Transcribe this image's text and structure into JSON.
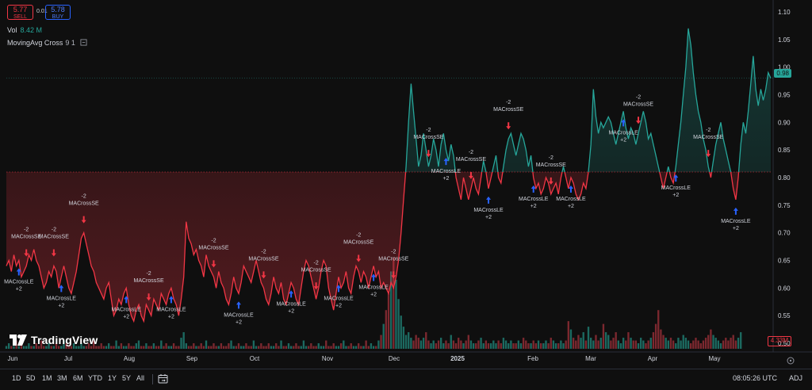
{
  "quote": {
    "sell_price": "5.77",
    "sell_label": "SELL",
    "spread": "0.01",
    "buy_price": "5.78",
    "buy_label": "BUY"
  },
  "legend": {
    "volume_label": "Vol",
    "volume_value": "8.42 M",
    "indicator_name": "MovingAvg Cross",
    "indicator_params": "9 1"
  },
  "watermark": "TradingView",
  "price_axis": [
    "1.10",
    "1.05",
    "1.00",
    "0.95",
    "0.90",
    "0.85",
    "0.80",
    "0.75",
    "0.70",
    "0.65",
    "0.60",
    "0.55",
    "0.50"
  ],
  "current_price_tag": "0.98",
  "volume_tag": "4.33M",
  "time_axis": [
    {
      "label": "Jun",
      "bold": false
    },
    {
      "label": "Jul",
      "bold": false
    },
    {
      "label": "Aug",
      "bold": false
    },
    {
      "label": "Sep",
      "bold": false
    },
    {
      "label": "Oct",
      "bold": false
    },
    {
      "label": "Nov",
      "bold": false
    },
    {
      "label": "Dec",
      "bold": false
    },
    {
      "label": "2025",
      "bold": true
    },
    {
      "label": "Feb",
      "bold": false
    },
    {
      "label": "Mar",
      "bold": false
    },
    {
      "label": "Apr",
      "bold": false
    },
    {
      "label": "May",
      "bold": false
    }
  ],
  "toolbar": {
    "timeframes": [
      "1D",
      "5D",
      "1M",
      "3M",
      "6M",
      "YTD",
      "1Y",
      "5Y",
      "All"
    ],
    "clock": "08:05:26 UTC",
    "adj": "ADJ"
  },
  "signal_labels": {
    "short": "MACrossSE",
    "long": "MACrossLE",
    "short_qty": "-2",
    "long_qty": "+2"
  },
  "colors": {
    "up": "#26a69a",
    "down": "#f23645",
    "long_arrow": "#2962ff",
    "short_arrow": "#f23645",
    "background": "#0f0f0f",
    "axis_text": "#d1d4dc"
  },
  "chart_data": {
    "type": "baseline",
    "baseline": 0.81,
    "ylim": [
      0.49,
      1.11
    ],
    "price_series": [
      0.64,
      0.65,
      0.63,
      0.66,
      0.64,
      0.65,
      0.62,
      0.63,
      0.64,
      0.66,
      0.65,
      0.67,
      0.65,
      0.64,
      0.62,
      0.6,
      0.61,
      0.63,
      0.62,
      0.64,
      0.63,
      0.6,
      0.62,
      0.64,
      0.62,
      0.6,
      0.59,
      0.61,
      0.63,
      0.66,
      0.69,
      0.7,
      0.68,
      0.66,
      0.64,
      0.63,
      0.61,
      0.6,
      0.59,
      0.58,
      0.6,
      0.61,
      0.58,
      0.55,
      0.56,
      0.58,
      0.57,
      0.59,
      0.6,
      0.57,
      0.55,
      0.54,
      0.56,
      0.57,
      0.55,
      0.54,
      0.57,
      0.56,
      0.55,
      0.58,
      0.57,
      0.56,
      0.59,
      0.58,
      0.57,
      0.59,
      0.6,
      0.58,
      0.57,
      0.55,
      0.58,
      0.62,
      0.72,
      0.69,
      0.68,
      0.66,
      0.67,
      0.65,
      0.64,
      0.62,
      0.66,
      0.64,
      0.63,
      0.62,
      0.6,
      0.63,
      0.61,
      0.6,
      0.58,
      0.57,
      0.59,
      0.62,
      0.6,
      0.59,
      0.61,
      0.64,
      0.63,
      0.62,
      0.61,
      0.63,
      0.65,
      0.63,
      0.61,
      0.6,
      0.58,
      0.57,
      0.59,
      0.62,
      0.6,
      0.59,
      0.61,
      0.58,
      0.57,
      0.59,
      0.61,
      0.6,
      0.58,
      0.57,
      0.6,
      0.63,
      0.65,
      0.64,
      0.62,
      0.6,
      0.58,
      0.6,
      0.63,
      0.65,
      0.64,
      0.6,
      0.58,
      0.56,
      0.59,
      0.62,
      0.6,
      0.61,
      0.63,
      0.6,
      0.59,
      0.62,
      0.64,
      0.63,
      0.61,
      0.63,
      0.62,
      0.6,
      0.62,
      0.64,
      0.62,
      0.63,
      0.6,
      0.61,
      0.6,
      0.59,
      0.61,
      0.6,
      0.62,
      0.65,
      0.7,
      0.76,
      0.82,
      0.9,
      0.97,
      0.92,
      0.87,
      0.82,
      0.84,
      0.88,
      0.85,
      0.82,
      0.84,
      0.87,
      0.85,
      0.82,
      0.86,
      0.88,
      0.85,
      0.83,
      0.86,
      0.84,
      0.8,
      0.78,
      0.76,
      0.8,
      0.78,
      0.76,
      0.78,
      0.8,
      0.78,
      0.77,
      0.8,
      0.83,
      0.81,
      0.78,
      0.8,
      0.82,
      0.84,
      0.8,
      0.79,
      0.82,
      0.85,
      0.87,
      0.88,
      0.86,
      0.84,
      0.86,
      0.88,
      0.87,
      0.85,
      0.82,
      0.84,
      0.8,
      0.78,
      0.79,
      0.77,
      0.78,
      0.8,
      0.79,
      0.77,
      0.78,
      0.79,
      0.77,
      0.8,
      0.82,
      0.8,
      0.78,
      0.8,
      0.79,
      0.77,
      0.76,
      0.77,
      0.79,
      0.78,
      0.81,
      0.86,
      0.96,
      0.91,
      0.88,
      0.9,
      0.89,
      0.9,
      0.91,
      0.9,
      0.88,
      0.86,
      0.88,
      0.9,
      0.92,
      0.89,
      0.87,
      0.89,
      0.88,
      0.86,
      0.88,
      0.9,
      0.92,
      0.9,
      0.87,
      0.88,
      0.86,
      0.84,
      0.82,
      0.8,
      0.78,
      0.8,
      0.82,
      0.8,
      0.79,
      0.82,
      0.86,
      0.9,
      0.95,
      1.0,
      1.07,
      1.04,
      0.99,
      0.95,
      0.92,
      0.9,
      0.87,
      0.85,
      0.82,
      0.8,
      0.83,
      0.86,
      0.88,
      0.9,
      0.87,
      0.85,
      0.83,
      0.81,
      0.78,
      0.76,
      0.8,
      0.86,
      0.9,
      0.88,
      0.92,
      0.97,
      1.02,
      0.96,
      0.93,
      0.96,
      0.94,
      0.96,
      0.99,
      0.98
    ],
    "volume_series": [
      1,
      2,
      1,
      1,
      3,
      1,
      2,
      1,
      1,
      2,
      1,
      1,
      2,
      1,
      3,
      1,
      1,
      2,
      1,
      1,
      2,
      1,
      1,
      3,
      2,
      1,
      1,
      2,
      1,
      1,
      2,
      1,
      1,
      2,
      1,
      3,
      1,
      1,
      2,
      1,
      1,
      2,
      1,
      1,
      3,
      1,
      2,
      1,
      1,
      2,
      1,
      1,
      2,
      3,
      1,
      1,
      2,
      1,
      1,
      2,
      1,
      1,
      3,
      1,
      2,
      1,
      1,
      2,
      1,
      1,
      4,
      6,
      2,
      1,
      1,
      2,
      1,
      1,
      2,
      1,
      3,
      1,
      1,
      2,
      1,
      1,
      2,
      1,
      1,
      2,
      3,
      1,
      1,
      2,
      1,
      1,
      2,
      1,
      1,
      3,
      1,
      1,
      2,
      1,
      1,
      2,
      1,
      1,
      2,
      1,
      3,
      1,
      1,
      2,
      1,
      1,
      2,
      1,
      1,
      3,
      1,
      1,
      2,
      1,
      1,
      2,
      1,
      1,
      3,
      1,
      1,
      2,
      1,
      1,
      2,
      3,
      1,
      1,
      2,
      1,
      1,
      2,
      1,
      1,
      3,
      1,
      2,
      1,
      1,
      3,
      5,
      9,
      14,
      20,
      28,
      33,
      25,
      18,
      12,
      8,
      5,
      6,
      4,
      3,
      5,
      4,
      3,
      4,
      6,
      3,
      2,
      3,
      2,
      3,
      4,
      2,
      3,
      2,
      5,
      3,
      2,
      4,
      3,
      2,
      3,
      5,
      3,
      2,
      2,
      3,
      4,
      2,
      3,
      2,
      2,
      3,
      2,
      3,
      2,
      4,
      3,
      2,
      3,
      2,
      2,
      3,
      2,
      4,
      3,
      2,
      2,
      3,
      2,
      3,
      2,
      2,
      3,
      2,
      4,
      3,
      2,
      2,
      3,
      2,
      3,
      10,
      7,
      4,
      3,
      5,
      4,
      6,
      3,
      8,
      4,
      3,
      5,
      3,
      4,
      9,
      6,
      5,
      3,
      4,
      6,
      3,
      2,
      4,
      3,
      6,
      4,
      3,
      3,
      2,
      4,
      3,
      2,
      3,
      4,
      6,
      9,
      14,
      7,
      5,
      4,
      3,
      4,
      3,
      2,
      4,
      3,
      5,
      4,
      3,
      2,
      3,
      4,
      3,
      2,
      3,
      4,
      5,
      7,
      5,
      4,
      3,
      2,
      3,
      4,
      3,
      4,
      5,
      3,
      4,
      6
    ],
    "short_signals": [
      {
        "i": 8,
        "qty": "-2"
      },
      {
        "i": 19,
        "qty": "-2"
      },
      {
        "i": 31,
        "qty": "-2"
      },
      {
        "i": 57,
        "qty": "-2"
      },
      {
        "i": 83,
        "qty": "-2"
      },
      {
        "i": 103,
        "qty": "-2"
      },
      {
        "i": 124,
        "qty": "-2"
      },
      {
        "i": 141,
        "qty": "-2"
      },
      {
        "i": 155,
        "qty": "-2"
      },
      {
        "i": 169,
        "qty": "-2"
      },
      {
        "i": 186,
        "qty": "-2"
      },
      {
        "i": 201,
        "qty": "-2"
      },
      {
        "i": 218,
        "qty": "-2"
      },
      {
        "i": 253,
        "qty": "-2"
      },
      {
        "i": 281,
        "qty": "-2"
      }
    ],
    "long_signals": [
      {
        "i": 5,
        "qty": "+2"
      },
      {
        "i": 22,
        "qty": "+2"
      },
      {
        "i": 48,
        "qty": "+2"
      },
      {
        "i": 66,
        "qty": "+2"
      },
      {
        "i": 93,
        "qty": "+2"
      },
      {
        "i": 114,
        "qty": "+2"
      },
      {
        "i": 133,
        "qty": "+2"
      },
      {
        "i": 147,
        "qty": "+2"
      },
      {
        "i": 176,
        "qty": "+2"
      },
      {
        "i": 193,
        "qty": "+2"
      },
      {
        "i": 211,
        "qty": "+2"
      },
      {
        "i": 226,
        "qty": "+2"
      },
      {
        "i": 247,
        "qty": "+2"
      },
      {
        "i": 268,
        "qty": "+2"
      },
      {
        "i": 292,
        "qty": "+2"
      }
    ]
  }
}
